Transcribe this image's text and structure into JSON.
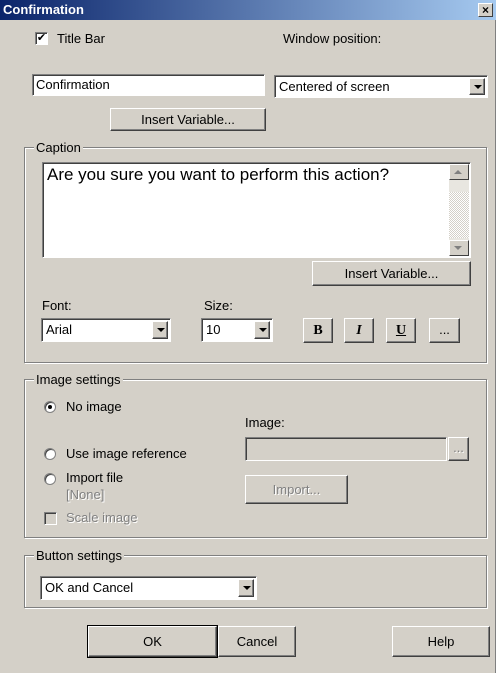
{
  "window": {
    "title": "Confirmation",
    "close_icon": "×"
  },
  "title_bar": {
    "checkbox_label": "Title Bar",
    "checked": true,
    "check_glyph": "✔",
    "value": "Confirmation",
    "insert_variable": "Insert Variable..."
  },
  "window_position": {
    "label": "Window position:",
    "selected": "Centered of screen"
  },
  "caption": {
    "legend": "Caption",
    "text": "Are you sure you want to perform this action?",
    "insert_variable": "Insert Variable...",
    "font_label": "Font:",
    "font_value": "Arial",
    "size_label": "Size:",
    "size_value": "10",
    "bold": "B",
    "italic": "I",
    "underline": "U",
    "more": "..."
  },
  "image_settings": {
    "legend": "Image settings",
    "no_image": "No image",
    "use_reference": "Use image reference",
    "import_file": "Import file",
    "none": "[None]",
    "scale_image": "Scale image",
    "image_label": "Image:",
    "browse": "...",
    "import_button": "Import..."
  },
  "button_settings": {
    "legend": "Button settings",
    "selected": "OK and Cancel"
  },
  "footer": {
    "ok": "OK",
    "cancel": "Cancel",
    "help": "Help"
  }
}
